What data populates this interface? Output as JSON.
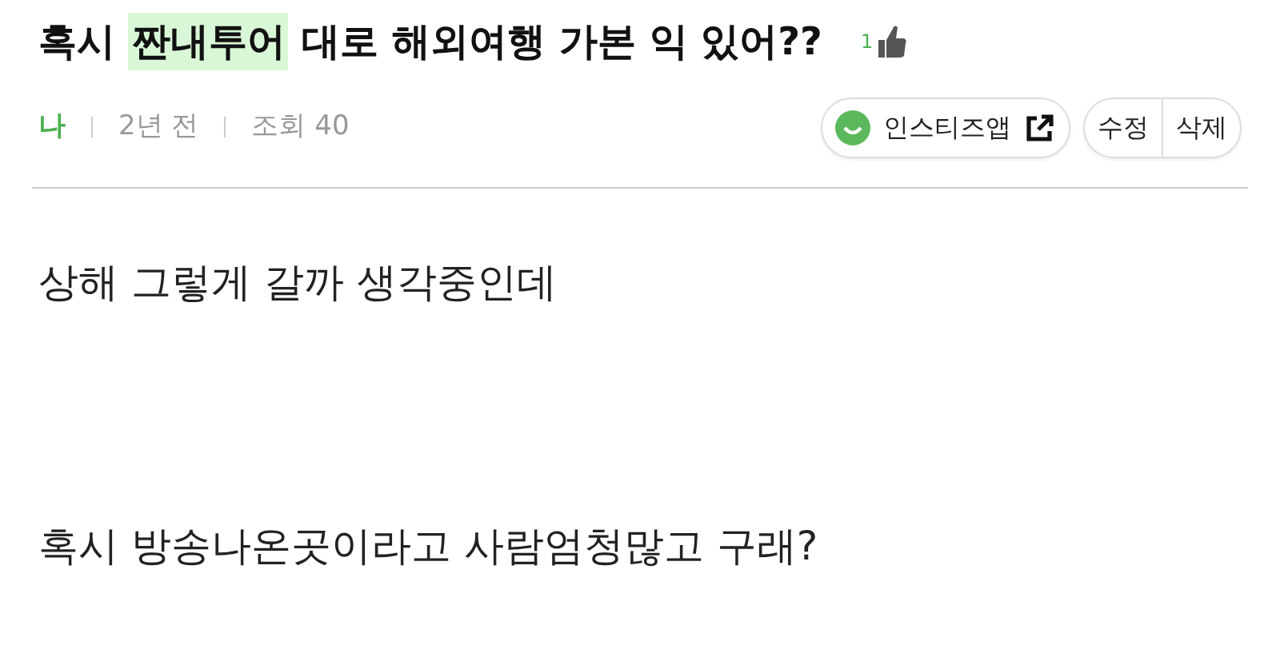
{
  "post": {
    "title_parts": [
      {
        "text": "혹시 ",
        "highlighted": false
      },
      {
        "text": "짠내투어",
        "highlighted": true
      },
      {
        "text": " 대로 해외여행 가본 익 있어??",
        "highlighted": false
      }
    ],
    "like_count": "1",
    "author": "나",
    "time": "2년 전",
    "views": "조회 40",
    "share_button": "인스티즈앱",
    "actions": [
      "수정",
      "삭제"
    ],
    "paragraphs": [
      "상해 그렇게 갈까 생각중인데",
      "혹시 방송나온곳이라고 사람엄청많고 구래?"
    ]
  }
}
